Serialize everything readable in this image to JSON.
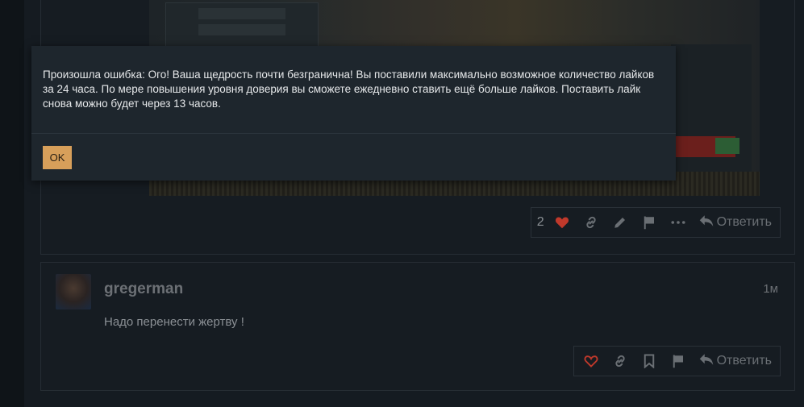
{
  "post1": {
    "like_count": "2",
    "reply_label": "Ответить"
  },
  "post2": {
    "username": "gregerman",
    "time": "1м",
    "text": "Надо перенести жертву !",
    "reply_label": "Ответить"
  },
  "modal": {
    "message": "Произошла ошибка: Ого! Ваша щедрость почти безгранична! Вы поставили максимально возможное количество лайков за 24 часа. По мере повышения уровня доверия вы сможете ежедневно ставить ещё больше лайков. Поставить лайк снова можно будет через 13 часов.",
    "ok_label": "OK"
  },
  "colors": {
    "accent": "#d79f5a",
    "heart_liked": "#c0392b",
    "heart_outline": "#c0392b"
  },
  "icons": [
    "heart-icon",
    "link-icon",
    "pencil-icon",
    "flag-icon",
    "more-icon",
    "reply-icon",
    "bookmark-icon"
  ]
}
